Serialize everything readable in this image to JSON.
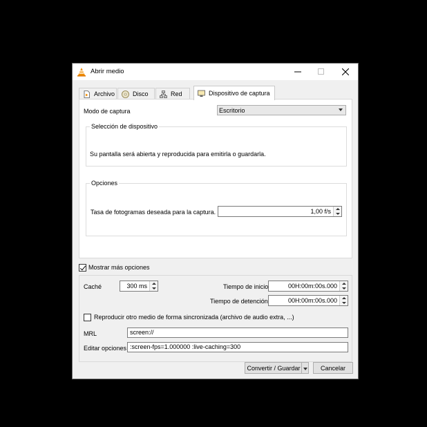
{
  "window": {
    "title": "Abrir medio",
    "icon": "vlc-cone-icon",
    "buttons": [
      "minimize-icon",
      "maximize-icon",
      "close-icon"
    ]
  },
  "tabs": [
    {
      "label": "Archivo",
      "icon": "file-icon"
    },
    {
      "label": "Disco",
      "icon": "disc-icon"
    },
    {
      "label": "Red",
      "icon": "network-icon"
    },
    {
      "label": "Dispositivo de captura",
      "icon": "capture-device-icon",
      "active": true
    }
  ],
  "capture": {
    "mode_label": "Modo de captura",
    "mode_value": "Escritorio",
    "device_group_title": "Selección de dispositivo",
    "device_message": "Su pantalla será abierta y reproducida para emitirla o guardarla.",
    "options_group_title": "Opciones",
    "fps_label": "Tasa de fotogramas deseada para la captura.",
    "fps_value": "1,00 f/s"
  },
  "more_options": {
    "checkbox_label": "Mostrar más opciones",
    "checked": true,
    "cache_label": "Caché",
    "cache_value": "300 ms",
    "start_time_label": "Tiempo de inicio",
    "start_time_value": "00H:00m:00s.000",
    "stop_time_label": "Tiempo de detención",
    "stop_time_value": "00H:00m:00s.000",
    "sync_label": "Reproducir otro medio de forma sincronizada (archivo de audio extra, ...)",
    "sync_checked": false,
    "mrl_label": "MRL",
    "mrl_value": "screen://",
    "edit_options_label": "Editar opciones",
    "edit_options_value": ":screen-fps=1.000000 :live-caching=300"
  },
  "footer": {
    "convert_label": "Convertir / Guardar",
    "cancel_label": "Cancelar"
  },
  "colors": {
    "accent_orange": "#f08c00",
    "window_bg": "#f0f0f0",
    "panel_bg": "#ffffff"
  }
}
